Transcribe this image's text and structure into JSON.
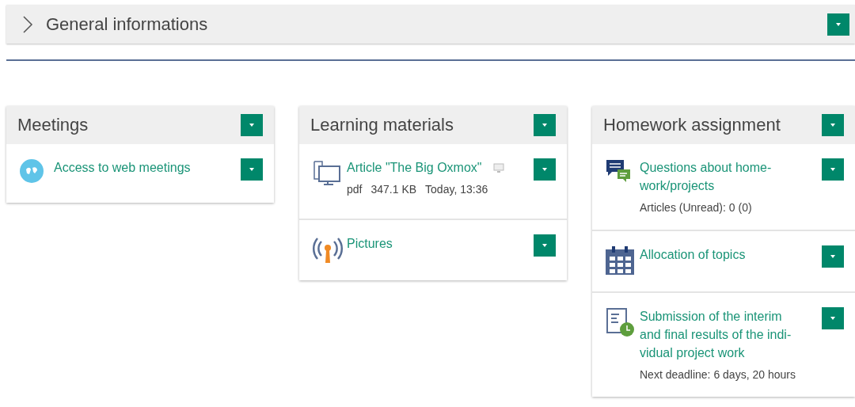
{
  "section": {
    "title": "General informations",
    "expanded": false
  },
  "columns": [
    {
      "title": "Meetings",
      "items": [
        {
          "kind": "meeting",
          "title": "Access to web meetings"
        }
      ]
    },
    {
      "title": "Learning materials",
      "items": [
        {
          "kind": "file",
          "title": "Article \"The Big Oxmox\"",
          "meta": [
            "pdf",
            "347.1 KB",
            "Today, 13:36"
          ],
          "screen_mark": true
        },
        {
          "kind": "feed",
          "title": "Pictures"
        }
      ]
    },
    {
      "title": "Homework assignment",
      "items": [
        {
          "kind": "forum",
          "title": "Questions about home-work/projects",
          "meta": [
            "Articles (Unread): 0 (0)"
          ]
        },
        {
          "kind": "calendar",
          "title": "Allocation of topics"
        },
        {
          "kind": "task",
          "title": "Submission of the interim and final results of the indi-vidual project work",
          "meta": [
            "Next deadline: 6 days, 20 hours"
          ]
        }
      ]
    }
  ]
}
